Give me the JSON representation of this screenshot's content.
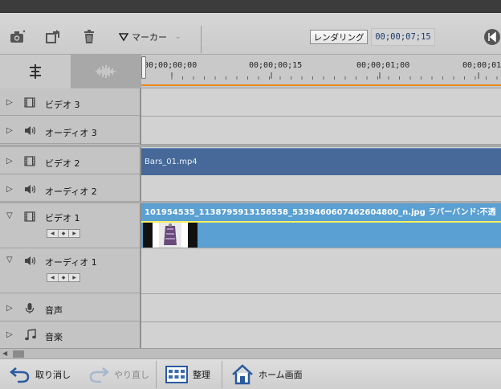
{
  "toolbar": {
    "marker_label": "マーカー",
    "render_label": "レンダリング",
    "timecode": "00;00;07;15"
  },
  "ruler": {
    "timecodes": [
      "00;00;00;00",
      "00;00;00;15",
      "00;00;01;00",
      "00;00;01;"
    ]
  },
  "tracks": [
    {
      "name": "ビデオ 3",
      "type": "video"
    },
    {
      "name": "オーディオ 3",
      "type": "audio"
    },
    {
      "name": "ビデオ 2",
      "type": "video"
    },
    {
      "name": "オーディオ 2",
      "type": "audio"
    },
    {
      "name": "ビデオ 1",
      "type": "video"
    },
    {
      "name": "オーディオ 1",
      "type": "audio"
    },
    {
      "name": "音声",
      "type": "narration"
    },
    {
      "name": "音楽",
      "type": "music"
    }
  ],
  "clips": {
    "bars": "Bars_01.mp4",
    "photo": "101954535_1138795913156558_5339460607462604800_n.jpg ラバーバンド:不透"
  },
  "bottom": {
    "undo": "取り消し",
    "redo": "やり直し",
    "organize": "整理",
    "home": "ホーム画面"
  },
  "colors": {
    "clip_video": "#46699a",
    "clip_photo": "#5aa0d2",
    "playhead_line": "#e8891a",
    "rubber_band": "#f4f060"
  }
}
